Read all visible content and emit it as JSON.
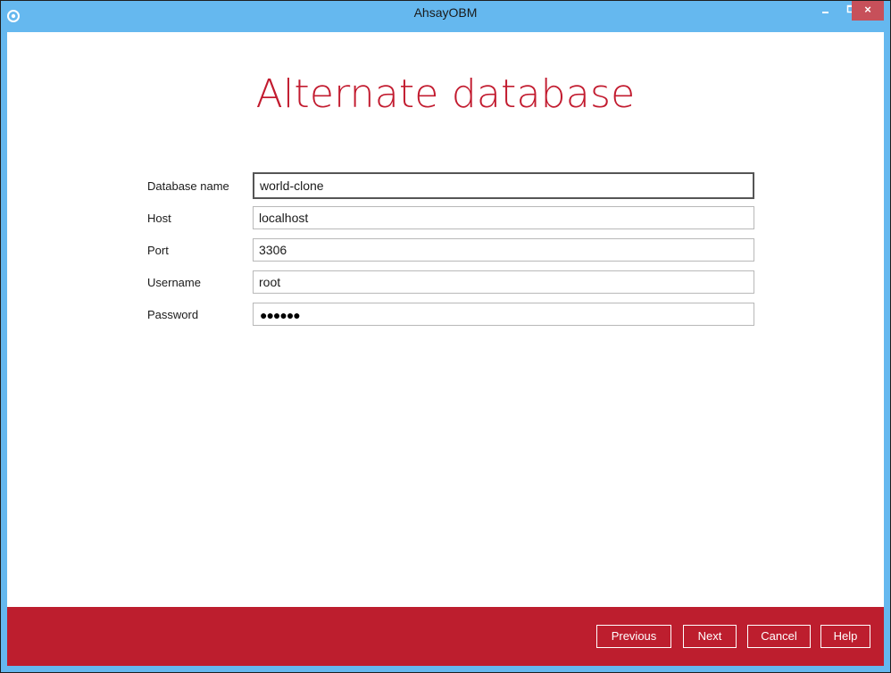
{
  "window": {
    "title": "AhsayOBM",
    "controls": {
      "minimize": "minimize-icon",
      "maximize": "maximize-icon",
      "close": "close-icon"
    }
  },
  "page": {
    "title": "Alternate database"
  },
  "form": {
    "database_name": {
      "label": "Database name",
      "value": "world-clone"
    },
    "host": {
      "label": "Host",
      "value": "localhost"
    },
    "port": {
      "label": "Port",
      "value": "3306"
    },
    "username": {
      "label": "Username",
      "value": "root"
    },
    "password": {
      "label": "Password",
      "masked_value": "●●●●●●"
    }
  },
  "footer": {
    "previous_label": "Previous",
    "next_label": "Next",
    "cancel_label": "Cancel",
    "help_label": "Help"
  },
  "colors": {
    "titlebar": "#65b8ef",
    "accent_red": "#bd1e2e",
    "title_red": "#c21b2f",
    "close_button": "#c7505a"
  }
}
